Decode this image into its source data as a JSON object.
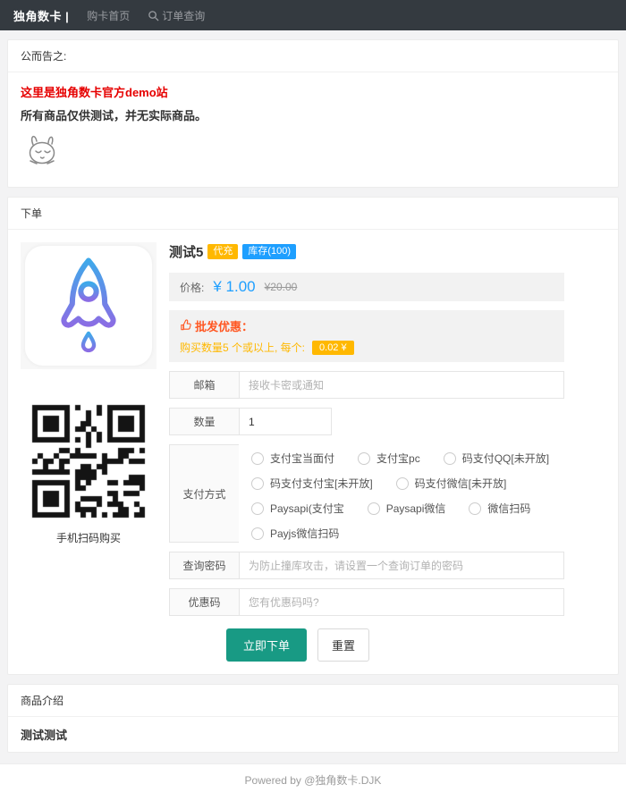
{
  "navbar": {
    "brand": "独角数卡 |",
    "links": [
      {
        "label": "购卡首页"
      },
      {
        "label": "订单查询",
        "icon": "search-icon"
      }
    ]
  },
  "announcement": {
    "header": "公而告之:",
    "line1": "这里是独角数卡官方demo站",
    "line2": "所有商品仅供测试，并无实际商品。"
  },
  "order": {
    "header": "下单",
    "product": {
      "title": "测试5",
      "badges": [
        {
          "label": "代充",
          "color": "#FFB800"
        },
        {
          "label": "库存(100)",
          "color": "#1E9FFF"
        }
      ],
      "price_label": "价格:",
      "price": "¥ 1.00",
      "original_price": "¥20.00",
      "wholesale_icon": "thumb-up-icon",
      "wholesale_title": "批发优惠：",
      "wholesale_desc": "购买数量5 个或以上, 每个:",
      "wholesale_badge": "0.02 ¥",
      "image": "rocket-icon",
      "qr_caption": "手机扫码购买"
    },
    "form": {
      "email_label": "邮箱",
      "email_placeholder": "接收卡密或通知",
      "quantity_label": "数量",
      "quantity_value": "1",
      "payment_label": "支付方式",
      "payment_options": [
        "支付宝当面付",
        "支付宝pc",
        "码支付QQ[未开放]",
        "码支付支付宝[未开放]",
        "码支付微信[未开放]",
        "Paysapi(支付宝",
        "Paysapi微信",
        "微信扫码",
        "Payjs微信扫码"
      ],
      "search_pwd_label": "查询密码",
      "search_pwd_placeholder": "为防止撞库攻击，请设置一个查询订单的密码",
      "coupon_label": "优惠码",
      "coupon_placeholder": "您有优惠码吗?",
      "submit_label": "立即下单",
      "reset_label": "重置"
    }
  },
  "description": {
    "header": "商品介绍",
    "body": "测试测试"
  },
  "footer": {
    "text": "Powered by @独角数卡.DJK"
  },
  "colors": {
    "navbar_bg": "#343a40",
    "price_blue": "#1E9FFF",
    "badge_orange": "#FFB800",
    "wholesale_red": "#FF5722",
    "announcement_red": "#e60000",
    "submit_teal": "#189a84"
  }
}
